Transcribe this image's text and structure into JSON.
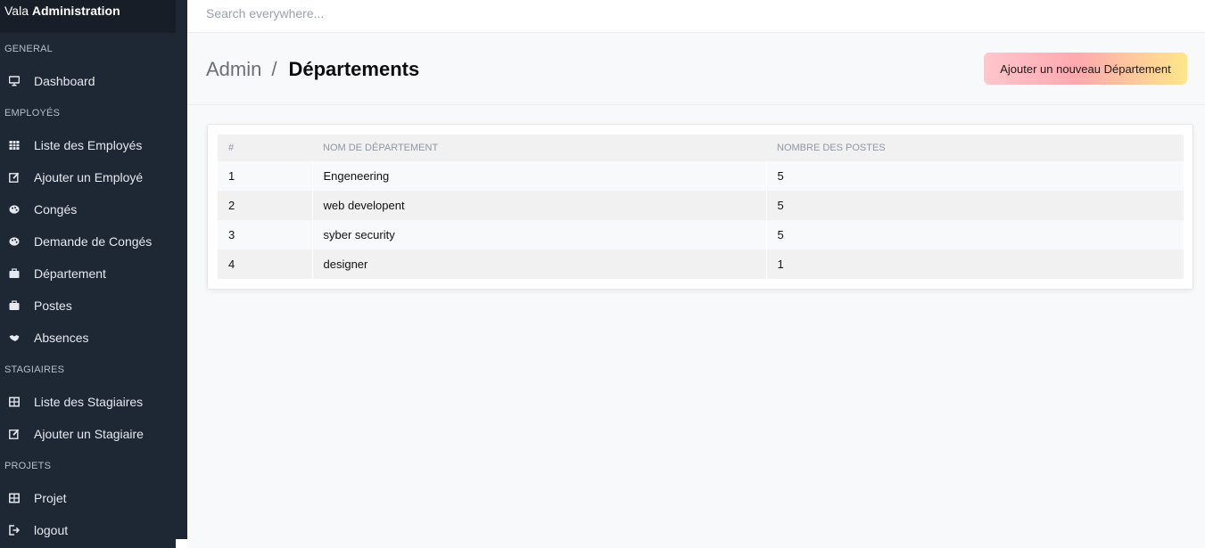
{
  "brand": {
    "prefix": "Vala",
    "name": "Administration"
  },
  "search": {
    "placeholder": "Search everywhere..."
  },
  "sidebar": {
    "sections": [
      {
        "label": "GENERAL",
        "items": [
          {
            "label": "Dashboard",
            "icon": "monitor-icon"
          }
        ]
      },
      {
        "label": "EMPLOYÉS",
        "items": [
          {
            "label": "Liste des Employés",
            "icon": "table-icon"
          },
          {
            "label": "Ajouter un Employé",
            "icon": "edit-icon"
          },
          {
            "label": "Congés",
            "icon": "palette-icon"
          },
          {
            "label": "Demande de Congés",
            "icon": "palette-icon"
          },
          {
            "label": "Département",
            "icon": "briefcase-icon"
          },
          {
            "label": "Postes",
            "icon": "briefcase-icon"
          },
          {
            "label": "Absences",
            "icon": "handshake-icon"
          }
        ]
      },
      {
        "label": "STAGIAIRES",
        "items": [
          {
            "label": "Liste des Stagiaires",
            "icon": "grid-icon"
          },
          {
            "label": "Ajouter un Stagiaire",
            "icon": "edit-icon"
          }
        ]
      },
      {
        "label": "PROJETS",
        "items": [
          {
            "label": "Projet",
            "icon": "grid-icon"
          },
          {
            "label": "logout",
            "icon": "sign-out-icon"
          }
        ]
      }
    ]
  },
  "header": {
    "breadcrumb_root": "Admin",
    "breadcrumb_sep": "/",
    "title": "Départements",
    "add_button": "Ajouter un nouveau Département"
  },
  "table": {
    "columns": [
      "#",
      "NOM DE DÉPARTEMENT",
      "NOMBRE DES POSTES"
    ],
    "rows": [
      [
        "1",
        "Engeneering",
        "5"
      ],
      [
        "2",
        "web developent",
        "5"
      ],
      [
        "3",
        "syber security",
        "5"
      ],
      [
        "4",
        "designer",
        "1"
      ]
    ]
  },
  "colors": {
    "sidebar_bg": "#1e2734",
    "button_gradient": [
      "#ffc6cc",
      "#ffa9b0",
      "#ffe68a"
    ]
  }
}
